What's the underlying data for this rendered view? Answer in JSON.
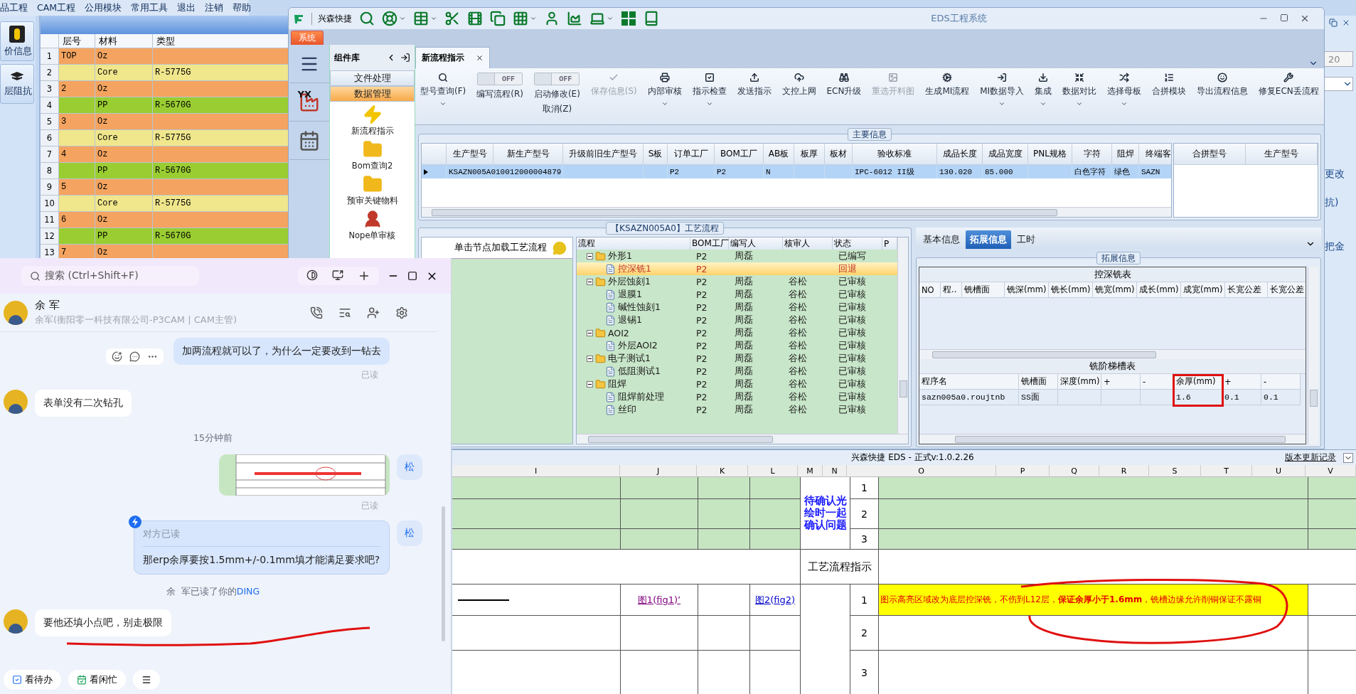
{
  "background_app": {
    "menu": [
      "品工程",
      "CAM工程",
      "公用模块",
      "常用工具",
      "退出",
      "注销",
      "帮助"
    ],
    "side_buttons": [
      "价信息",
      "层阻抗"
    ],
    "stack_table": {
      "columns": [
        "层号",
        "材料",
        "类型"
      ],
      "rows": [
        {
          "no": "1",
          "layer": "TOP",
          "material": "Oz",
          "color": "#f4a460"
        },
        {
          "no": "2",
          "material": "Core",
          "type": "R-5775G",
          "color": "#f0e68c"
        },
        {
          "no": "3",
          "layer": "2",
          "material": "Oz",
          "color": "#f4a460"
        },
        {
          "no": "4",
          "material": "PP",
          "type": "R-5670G",
          "color": "#9acd32"
        },
        {
          "no": "5",
          "layer": "3",
          "material": "Oz",
          "color": "#f4a460"
        },
        {
          "no": "6",
          "material": "Core",
          "type": "R-5775G",
          "color": "#f0e68c"
        },
        {
          "no": "7",
          "layer": "4",
          "material": "Oz",
          "color": "#f4a460"
        },
        {
          "no": "8",
          "material": "PP",
          "type": "R-5670G",
          "color": "#9acd32"
        },
        {
          "no": "9",
          "layer": "5",
          "material": "Oz",
          "color": "#f4a460"
        },
        {
          "no": "10",
          "material": "Core",
          "type": "R-5775G",
          "color": "#f0e68c"
        },
        {
          "no": "11",
          "layer": "6",
          "material": "Oz",
          "color": "#f4a460"
        },
        {
          "no": "12",
          "material": "PP",
          "type": "R-5670G",
          "color": "#9acd32"
        },
        {
          "no": "13",
          "layer": "7",
          "material": "Oz",
          "color": "#f4a460"
        }
      ]
    },
    "side_strip": {
      "field_value": "20",
      "labels": [
        "更改",
        "抗)",
        "把金"
      ]
    }
  },
  "eds_window": {
    "title": "EDS工程系统",
    "brand": "兴森快捷",
    "system_tab": "系统",
    "strip_badge": "YX",
    "component_panel": {
      "title": "组件库",
      "sections": [
        {
          "label": "文件处理",
          "selected": false
        },
        {
          "label": "数据管理",
          "selected": true
        }
      ],
      "items": [
        "新流程指示",
        "Bom查询2",
        "预审关键物料",
        "Nope单审核"
      ]
    },
    "doc_tab": {
      "label": "新流程指示",
      "selected": true
    },
    "ribbon": [
      {
        "kind": "button",
        "label": "型号查询(F)",
        "dropdown": true,
        "disabled": false
      },
      {
        "kind": "toggle",
        "label": "编写流程(R)",
        "switch_text": "OFF",
        "on": false
      },
      {
        "kind": "toggle",
        "label": "启动修改(E)",
        "sublabel": "取消(Z)",
        "switch_text": "OFF",
        "on": false
      },
      {
        "kind": "button",
        "label": "保存信息(S)",
        "dropdown": false,
        "disabled": true
      },
      {
        "kind": "button",
        "label": "内部审核",
        "dropdown": true,
        "disabled": false
      },
      {
        "kind": "button",
        "label": "指示检查",
        "dropdown": true,
        "disabled": false
      },
      {
        "kind": "button",
        "label": "发送指示",
        "dropdown": false,
        "disabled": false
      },
      {
        "kind": "button",
        "label": "文控上网",
        "dropdown": false,
        "disabled": false
      },
      {
        "kind": "button",
        "label": "ECN升级",
        "dropdown": false,
        "disabled": false
      },
      {
        "kind": "button",
        "label": "重选开料图",
        "dropdown": false,
        "disabled": true
      },
      {
        "kind": "button",
        "label": "生成MI流程",
        "dropdown": false,
        "disabled": false
      },
      {
        "kind": "button",
        "label": "MI数据导入",
        "dropdown": true,
        "disabled": false
      },
      {
        "kind": "button",
        "label": "集成",
        "dropdown": true,
        "disabled": false
      },
      {
        "kind": "button",
        "label": "数据对比",
        "dropdown": true,
        "disabled": false
      },
      {
        "kind": "button",
        "label": "选择母板",
        "dropdown": true,
        "disabled": false
      },
      {
        "kind": "button",
        "label": "合拼模块",
        "dropdown": false,
        "disabled": false
      },
      {
        "kind": "button",
        "label": "导出流程信息",
        "dropdown": false,
        "disabled": false
      },
      {
        "kind": "button",
        "label": "修复ECN丢流程",
        "dropdown": false,
        "disabled": false
      }
    ],
    "main_info": {
      "title": "主要信息",
      "columns": [
        "生产型号",
        "新生产型号",
        "升级前旧生产型号",
        "S板",
        "订单工厂",
        "BOM工厂",
        "AB板",
        "板厚",
        "板材",
        "验收标准",
        "成品长度",
        "成品宽度",
        "PNL规格",
        "字符",
        "阻焊",
        "终端客"
      ],
      "rows": [
        {
          "selected": true,
          "cells": [
            "KSAZN005A0",
            "10012000004879",
            null,
            null,
            "P2",
            "P2",
            "N",
            null,
            null,
            "IPC-6012 II级",
            "130.020",
            "85.000",
            null,
            "白色字符",
            "绿色",
            "SAZN"
          ]
        }
      ],
      "side_columns": [
        "合拼型号",
        "生产型号"
      ]
    },
    "process": {
      "title": "【KSAZN005A0】工艺流程",
      "hint": "单击节点加载工艺流程",
      "columns": [
        "流程",
        "BOM工厂",
        "编写人",
        "核审人",
        "状态",
        "P"
      ],
      "tree": [
        {
          "name": "外形1",
          "bom": "P2",
          "writer": "周磊",
          "status": "已编写",
          "selected": false,
          "expanded": true,
          "children": [
            {
              "name": "控深铣1",
              "bom": "P2",
              "status": "回退",
              "selected": true
            }
          ]
        },
        {
          "name": "外层蚀刻1",
          "bom": "P2",
          "writer": "周磊",
          "reviewer": "谷松",
          "status": "已审核",
          "selected": false,
          "expanded": true,
          "children": [
            {
              "name": "退膜1",
              "bom": "P2",
              "writer": "周磊",
              "reviewer": "谷松",
              "status": "已审核",
              "selected": false
            },
            {
              "name": "碱性蚀刻1",
              "bom": "P2",
              "writer": "周磊",
              "reviewer": "谷松",
              "status": "已审核",
              "selected": false
            },
            {
              "name": "退锡1",
              "bom": "P2",
              "writer": "周磊",
              "reviewer": "谷松",
              "status": "已审核",
              "selected": false
            }
          ]
        },
        {
          "name": "AOI2",
          "bom": "P2",
          "writer": "周磊",
          "reviewer": "谷松",
          "status": "已审核",
          "selected": false,
          "expanded": true,
          "children": [
            {
              "name": "外层AOI2",
              "bom": "P2",
              "writer": "周磊",
              "reviewer": "谷松",
              "status": "已审核",
              "selected": false
            }
          ]
        },
        {
          "name": "电子测试1",
          "bom": "P2",
          "writer": "周磊",
          "reviewer": "谷松",
          "status": "已审核",
          "selected": false,
          "expanded": true,
          "children": [
            {
              "name": "低阻测试1",
              "bom": "P2",
              "writer": "周磊",
              "reviewer": "谷松",
              "status": "已审核",
              "selected": false
            }
          ]
        },
        {
          "name": "阻焊",
          "bom": "P2",
          "writer": "周磊",
          "reviewer": "谷松",
          "status": "已审核",
          "selected": false,
          "expanded": true,
          "children": [
            {
              "name": "阻焊前处理",
              "bom": "P2",
              "writer": "周磊",
              "reviewer": "谷松",
              "status": "已审核",
              "selected": false
            },
            {
              "name": "丝印",
              "bom": "P2",
              "writer": "周磊",
              "reviewer": "谷松",
              "status": "已审核",
              "selected": false
            }
          ]
        }
      ]
    },
    "ext_tabs": [
      {
        "label": "基本信息",
        "selected": false
      },
      {
        "label": "拓展信息",
        "selected": true
      },
      {
        "label": "工时",
        "selected": false
      }
    ],
    "ext_group_title": "拓展信息",
    "deep_mill": {
      "title": "控深铣表",
      "columns": [
        "NO",
        "程..",
        "铣槽面",
        "铣深(mm)",
        "铣长(mm)",
        "铣宽(mm)",
        "成长(mm)",
        "成宽(mm)",
        "长宽公差",
        "长宽公差"
      ]
    },
    "step_slot": {
      "title": "铣阶梯槽表",
      "columns": [
        "程序名",
        "铣槽面",
        "深度(mm)",
        "+",
        "-",
        "余厚(mm)",
        "+",
        "-"
      ],
      "rows": [
        [
          "sazn005a0.roujtnb",
          "SS面",
          null,
          null,
          null,
          "1.6",
          "0.1",
          "0.1"
        ]
      ]
    }
  },
  "sheet": {
    "title": "兴森快捷 EDS - 正式v:1.0.2.26",
    "link": "版本更新记录",
    "columns": [
      "I",
      "J",
      "K",
      "L",
      "M",
      "N",
      "O",
      "P",
      "Q",
      "R",
      "S",
      "T",
      "U",
      "V"
    ],
    "note": "待确认光绘时一起确认问题",
    "upper_numbers": [
      "1",
      "2",
      "3"
    ],
    "flow_label": "工艺流程指示",
    "links": [
      {
        "text": "图1(fig1)’",
        "visited": true
      },
      {
        "text": "图2(fig2)",
        "visited": false
      }
    ],
    "lower_numbers": [
      "1",
      "2",
      "3"
    ],
    "instruction": "图示高亮区域改为底层控深铣，不伤到L12层，**保证余厚小于1.6mm**，铣槽边缘允许削铜保证不露铜"
  },
  "chat": {
    "search": {
      "placeholder": "搜索 (Ctrl+Shift+F)"
    },
    "contact": {
      "name": "余 军",
      "subtitle": "余军(衡阳零一科技有限公司-P3CAM | CAM主管)"
    },
    "messages": [
      {
        "kind": "text",
        "outgoing": true,
        "text": "加两流程就可以了，为什么一定要改到一钻去",
        "receipt": "已读",
        "show_actions": true
      },
      {
        "kind": "text",
        "outgoing": false,
        "text": "表单没有二次钻孔"
      },
      {
        "kind": "time",
        "text": "15分钟前"
      },
      {
        "kind": "image",
        "outgoing": true,
        "avatar": "松",
        "receipt": "已读"
      },
      {
        "kind": "ding",
        "outgoing": true,
        "avatar": "松",
        "status": "对方已读",
        "text": "那erp余厚要按1.5mm+/-0.1mm填才能满足要求吧?"
      },
      {
        "kind": "notice",
        "text": "余  军已读了你的",
        "highlight": "DING"
      },
      {
        "kind": "text",
        "outgoing": false,
        "text": "要他还填小点吧，别走极限"
      }
    ],
    "shortcuts": [
      "看待办",
      "看闲忙"
    ]
  },
  "annotations": [
    {
      "kind": "box"
    },
    {
      "kind": "underline"
    },
    {
      "kind": "circle"
    }
  ]
}
